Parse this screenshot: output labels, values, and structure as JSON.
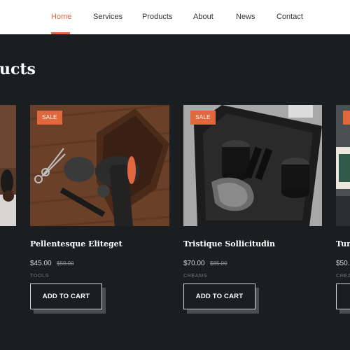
{
  "nav": {
    "items": [
      {
        "label": "Home",
        "active": true
      },
      {
        "label": "Services"
      },
      {
        "label": "Products"
      },
      {
        "label": "About"
      },
      {
        "label": "News"
      },
      {
        "label": "Contact"
      }
    ]
  },
  "section": {
    "title": "ucts"
  },
  "products": [
    {
      "name": "Pellentesque Eliteget",
      "price": "$45.00",
      "old_price": "$50.00",
      "category": "TOOLS",
      "badge": "SALE",
      "cta": "ADD TO CART"
    },
    {
      "name": "Tristique Sollicitudin",
      "price": "$70.00",
      "old_price": "$85.00",
      "category": "CREAMS",
      "badge": "SALE",
      "cta": "ADD TO CART"
    },
    {
      "name": "Tur",
      "price": "$50.",
      "category": "CREA",
      "badge": "",
      "cta": ""
    }
  ],
  "colors": {
    "accent": "#e2673d",
    "background": "#1b1e21",
    "nav_background": "#ffffff"
  }
}
